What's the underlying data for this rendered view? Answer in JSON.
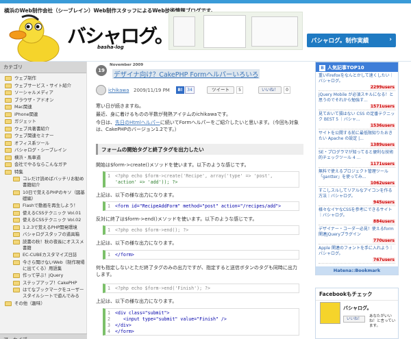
{
  "header": {
    "tagline": "横浜のWeb制作会社（シーブレイン）Web制作スタッフによるWeb技術情報ブログです。",
    "logo": "バシャログ。",
    "logo_sub": "basha-log",
    "promo": "バシャログ。制作実績",
    "promo_arrow": "›"
  },
  "sidebar": {
    "title": "カテゴリ",
    "items": [
      {
        "label": "ウェブ制作",
        "sub": false
      },
      {
        "label": "ウェブサービス・サイト紹介",
        "sub": false
      },
      {
        "label": "ソーシャルメディア",
        "sub": false
      },
      {
        "label": "ブラウザ・アドオン",
        "sub": false
      },
      {
        "label": "Mac関連",
        "sub": false
      },
      {
        "label": "iPhone関連",
        "sub": false
      },
      {
        "label": "ガジェット",
        "sub": false
      },
      {
        "label": "ウェブ共著書紹介",
        "sub": false
      },
      {
        "label": "ウェブ関連セミナー",
        "sub": false
      },
      {
        "label": "オフィス系ツール",
        "sub": false
      },
      {
        "label": "バシャログ・シーブレイン",
        "sub": false
      },
      {
        "label": "横浜・馬車道",
        "sub": false
      },
      {
        "label": "会社でやるならこんなガヂ",
        "sub": false
      },
      {
        "label": "特集",
        "sub": false
      },
      {
        "label": "コレだけ読めばバッチリお勧め書籍紹介",
        "sub": true
      },
      {
        "label": "10日で覚えるPHPのキソ（図基礎編）",
        "sub": true
      },
      {
        "label": "Flashで動画を再生しよう！",
        "sub": true
      },
      {
        "label": "使えるCSSテクニック Vol.01",
        "sub": true
      },
      {
        "label": "使えるCSSテクニック Vol.02",
        "sub": true
      },
      {
        "label": "1.2.3で覚えるPHP開発環境",
        "sub": true
      },
      {
        "label": "バシャログスタッフの道具箱",
        "sub": true
      },
      {
        "label": "読書の秋！秋の夜長にオススメ書籍",
        "sub": true
      },
      {
        "label": "EC-CUBEカスタマイズ日誌",
        "sub": true
      },
      {
        "label": "今さら聞けないWeb（制作現場に出てくる）用語集",
        "sub": true
      },
      {
        "label": "作って学ぶ！jQuery",
        "sub": true
      },
      {
        "label": "ステップアップ！CakePHP",
        "sub": true
      },
      {
        "label": "はてなブックマークをユーザースタイルシートで遊んでみる",
        "sub": true
      },
      {
        "label": "その他（趣味）",
        "sub": false
      }
    ],
    "archive_title": "アーカイブ"
  },
  "post": {
    "day": "19",
    "month_year": "November 2009",
    "title": "デザイナ向け？CakePHP Formヘルパーいろいろ",
    "author": "ichikawa",
    "datetime": "2009/11/19 PM",
    "hatena_label": "B!",
    "hatena_count": "34",
    "tweet_label": "ツイート",
    "tweet_count": "5",
    "like_label": "いいね！",
    "like_count": "0",
    "intro1": "寒い日が続きますね。",
    "intro2": "最近、身に着けるものの半数が発熱アイテムのichikawaです。",
    "intro3a": "今日は、",
    "intro3_link": "先日のHtmlヘルパー",
    "intro3b": "に続いてFormヘルパーをご紹介したいと思います。（今回も対象は、CakePHPのバージョン1.2です。）",
    "h3": "フォームの開始タグと終了タグを出力したい",
    "p1": "開始は$form->create()メソッドを使います。以下のような感じです。",
    "p2": "上記は、以下の様な出力になります。",
    "p3": "反対に終了は$form->end()メソッドを使います。以下のような感じです。",
    "p4": "上記は、以下の様な出力になります。",
    "p5": "何も指定しないとただ終了タグのみの出力ですが、指定すると送信ボタンのタグも同時に出力します。",
    "p6": "上記は、以下の様な出力になります。",
    "code1": {
      "ln": "1",
      "open": "<?php echo $form->create('Recipe', array('type' => 'post',",
      "line2": "'action' => 'add')); ?>"
    },
    "code2": {
      "ln": "1",
      "text": "<form id=\"RecipeAddForm\" method=\"post\" action=\"/recipes/add\">"
    },
    "code3": {
      "ln": "1",
      "text": "<?php echo $form->end(); ?>"
    },
    "code4": {
      "ln": "1",
      "text": "</form>"
    },
    "code5": {
      "ln": "1",
      "text": "<?php echo $form->end('Finish'); ?>"
    },
    "code6": {
      "ln1": "1",
      "l1": "<div class=\"submit\">",
      "ln2": "2",
      "l2": "<input type=\"submit\" value=\"Finish\" />",
      "ln3": "3",
      "l3": "</div>",
      "ln4": "4",
      "l4": "</form>"
    }
  },
  "ranking": {
    "title": "人気記事TOP10",
    "icon": "B",
    "items": [
      {
        "title": "重いFirefoxをなんとかして速くしたい｜バシャログ。",
        "users": "2299users"
      },
      {
        "title": "jQuery Mobile が必須スキルになる！と思うのでそれから勉強す...",
        "users": "1571users"
      },
      {
        "title": "見ておいて損はない CSS の定番テクニック BEST 5 ｜バシャ...",
        "users": "1536users"
      },
      {
        "title": "サイトを公開する前に最低限知りたおきたい Apache の設定 |...",
        "users": "1389users"
      },
      {
        "title": "SE・プログラマが知ってると便利な技術的チェックツール 4 ...",
        "users": "1171users"
      },
      {
        "title": "無料で使えるプロジェクト管理ツール「gantter」を使ってみ...",
        "users": "1062users"
      },
      {
        "title": "すこしスルしてリアルなアイコンを作る方法｜バシャログ。",
        "users": "945users"
      },
      {
        "title": "様々なイヤなCSSを参考にできるサイト｜バシャログ。",
        "users": "884users"
      },
      {
        "title": "デザイナー・コーダー必見！使えるform関連jQueryプラグイン",
        "users": "770users"
      },
      {
        "title": "Apple 関連のフォントを手に入れよう｜バシャログ。",
        "users": "767users"
      }
    ],
    "footer": "Hatena::Bookmark"
  },
  "facebook": {
    "title": "Facebookもチェック",
    "name": "バシャログ。",
    "like": "いいね！",
    "note": "あなたがいいね！と言っています。"
  }
}
